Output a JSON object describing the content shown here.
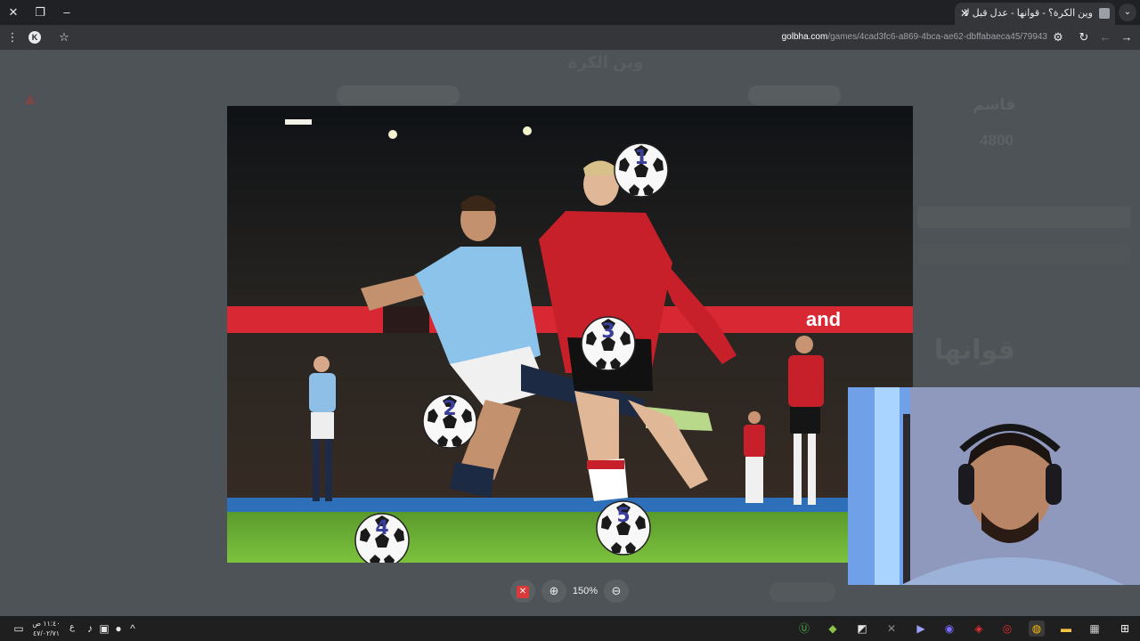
{
  "browser": {
    "tab_title": "وين الكرة؟ - قوانها - عدل قبل لا",
    "url_host": "golbha.com",
    "url_path": "/games/4cad3fc6-a869-4bca-ae62-dbffabaeca45/79943",
    "new_tab_label": "+",
    "close_tab_label": "✕"
  },
  "page": {
    "ghost_title": "وين الكرة",
    "ghost_name": "قاسم",
    "ghost_score": "4800",
    "ghost_logo": "قوانها"
  },
  "game": {
    "balls": [
      {
        "number": "1"
      },
      {
        "number": "2"
      },
      {
        "number": "3"
      },
      {
        "number": "4"
      },
      {
        "number": "5"
      }
    ],
    "stadium_board_text": "and"
  },
  "viewer": {
    "close_icon": "close-icon",
    "zoom_in_label": "⊕",
    "zoom_level": "150%",
    "zoom_out_label": "⊖"
  },
  "taskbar": {
    "clock_time": "١١:٤٠ ص",
    "clock_date": "٤٧/٠٢/٧١",
    "lang": "ع"
  },
  "colors": {
    "accent_red": "#d93a3a",
    "page_dim": "#4e5357"
  }
}
